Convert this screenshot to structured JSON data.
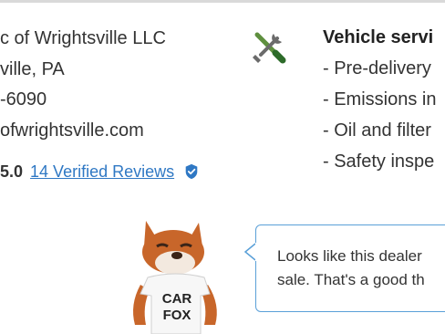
{
  "dealer": {
    "name": "c of Wrightsville LLC",
    "location": "ville, PA",
    "phone": "-6090",
    "website": "ofwrightsville.com",
    "rating": "5.0",
    "reviews_link": "14 Verified Reviews"
  },
  "services": {
    "title": "Vehicle servi",
    "items": [
      "- Pre-delivery",
      "- Emissions in",
      "- Oil and filter",
      "- Safety inspe"
    ]
  },
  "mascot": {
    "shirt_line1": "CAR",
    "shirt_line2": "FOX"
  },
  "callout": {
    "line1": "Looks like this dealer",
    "line2": "sale. That's a good th"
  },
  "colors": {
    "link": "#2f78c4",
    "bubble_border": "#5aa0d8",
    "fox_orange": "#c8662a"
  },
  "icons": [
    "tools-icon",
    "verified-badge-icon",
    "carfox-mascot"
  ]
}
